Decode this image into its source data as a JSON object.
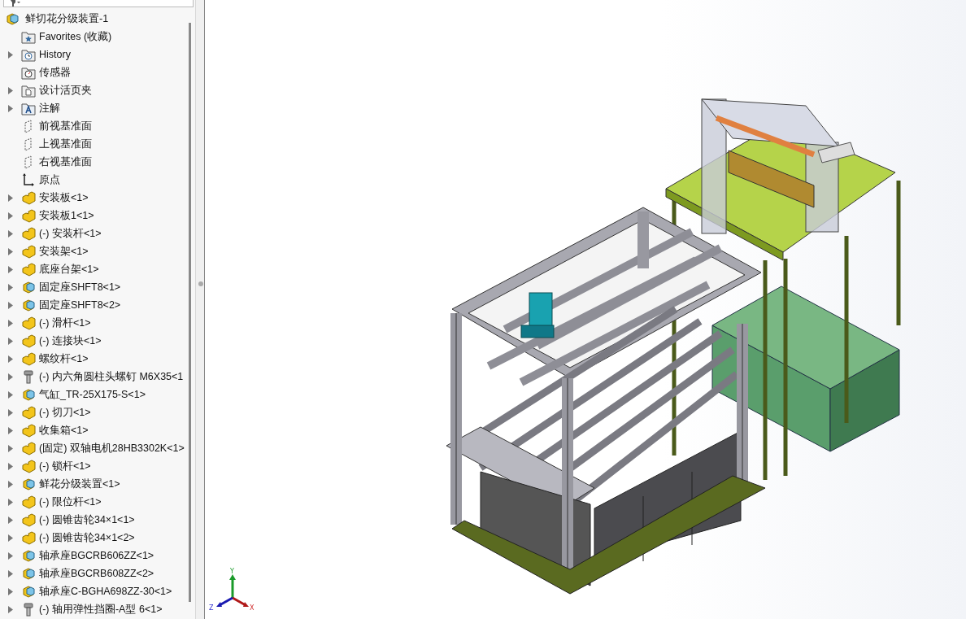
{
  "feature_tree": {
    "root": {
      "label": "鲜切花分级装置-1",
      "kind": "subassembly"
    },
    "items": [
      {
        "label": "Favorites (收藏)",
        "kind": "favorites",
        "expandable": false
      },
      {
        "label": "History",
        "kind": "history",
        "expandable": true
      },
      {
        "label": "传感器",
        "kind": "sensors",
        "expandable": false
      },
      {
        "label": "设计活页夹",
        "kind": "binder",
        "expandable": true
      },
      {
        "label": "注解",
        "kind": "annotations",
        "expandable": true
      },
      {
        "label": "前视基准面",
        "kind": "plane",
        "expandable": false
      },
      {
        "label": "上视基准面",
        "kind": "plane",
        "expandable": false
      },
      {
        "label": "右视基准面",
        "kind": "plane",
        "expandable": false
      },
      {
        "label": "原点",
        "kind": "origin",
        "expandable": false
      },
      {
        "label": "安装板<1>",
        "kind": "part",
        "expandable": true
      },
      {
        "label": "安装板1<1>",
        "kind": "part",
        "expandable": true
      },
      {
        "label": "(-) 安装杆<1>",
        "kind": "part",
        "expandable": true
      },
      {
        "label": "安装架<1>",
        "kind": "part",
        "expandable": true
      },
      {
        "label": "底座台架<1>",
        "kind": "part",
        "expandable": true
      },
      {
        "label": "固定座SHFT8<1>",
        "kind": "subassembly",
        "expandable": true
      },
      {
        "label": "固定座SHFT8<2>",
        "kind": "subassembly",
        "expandable": true
      },
      {
        "label": "(-) 滑杆<1>",
        "kind": "part",
        "expandable": true
      },
      {
        "label": "(-) 连接块<1>",
        "kind": "part",
        "expandable": true
      },
      {
        "label": "螺纹杆<1>",
        "kind": "part",
        "expandable": true
      },
      {
        "label": "(-) 内六角圆柱头螺钉 M6X35<1",
        "kind": "fastener",
        "expandable": true
      },
      {
        "label": "气缸_TR-25X175-S<1>",
        "kind": "subassembly",
        "expandable": true
      },
      {
        "label": "(-) 切刀<1>",
        "kind": "part",
        "expandable": true
      },
      {
        "label": "收集箱<1>",
        "kind": "part",
        "expandable": true
      },
      {
        "label": "(固定) 双轴电机28HB3302K<1>",
        "kind": "part",
        "expandable": true
      },
      {
        "label": "(-) 锁杆<1>",
        "kind": "part",
        "expandable": true
      },
      {
        "label": "鲜花分级装置<1>",
        "kind": "subassembly",
        "expandable": true
      },
      {
        "label": "(-) 限位杆<1>",
        "kind": "part",
        "expandable": true
      },
      {
        "label": "(-) 圆锥齿轮34×1<1>",
        "kind": "part",
        "expandable": true
      },
      {
        "label": "(-) 圆锥齿轮34×1<2>",
        "kind": "part",
        "expandable": true
      },
      {
        "label": "轴承座BGCRB606ZZ<1>",
        "kind": "subassembly",
        "expandable": true
      },
      {
        "label": "轴承座BGCRB608ZZ<2>",
        "kind": "subassembly",
        "expandable": true
      },
      {
        "label": "轴承座C-BGHA698ZZ-30<1>",
        "kind": "subassembly",
        "expandable": true
      },
      {
        "label": "(-) 轴用弹性挡圈-A型 6<1>",
        "kind": "fastener",
        "expandable": true
      }
    ]
  },
  "triad": {
    "x": "X",
    "y": "Y",
    "z": "Z"
  }
}
